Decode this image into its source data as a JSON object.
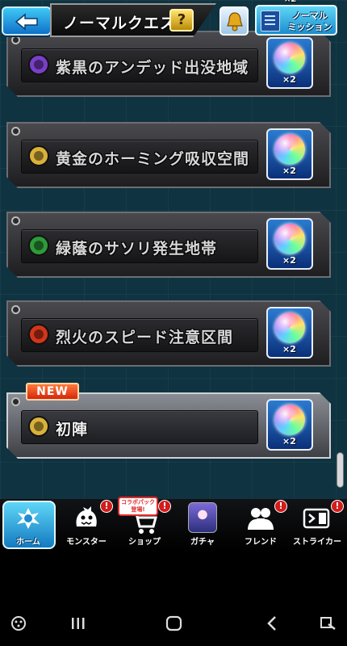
{
  "header": {
    "title": "ノーマルクエスト",
    "help_label": "?",
    "mission_line1": "ノーマル",
    "mission_line2": "ミッション"
  },
  "quests": [
    {
      "name": "紫黒のアンデッド出没地域",
      "element": "dark",
      "element_color": "#7a3fc8",
      "reward": "×2"
    },
    {
      "name": "黄金のホーミング吸収空間",
      "element": "light",
      "element_color": "#d9b23a",
      "reward": "×2"
    },
    {
      "name": "緑蔭のサソリ発生地帯",
      "element": "wood",
      "element_color": "#2f9a3a",
      "reward": "×2"
    },
    {
      "name": "烈火のスピード注意区間",
      "element": "fire",
      "element_color": "#d2361a",
      "reward": "×2"
    },
    {
      "name": "初陣",
      "element": "light",
      "element_color": "#d9b23a",
      "reward": "×2",
      "badge": "NEW"
    }
  ],
  "partial_reward": "×2",
  "nav": {
    "items": [
      {
        "label": "ホーム",
        "icon": "home-icon",
        "active": true
      },
      {
        "label": "モンスター",
        "icon": "monster-icon",
        "alert": "!"
      },
      {
        "label": "ショップ",
        "icon": "shop-cart-icon",
        "alert": "!",
        "tag_line1": "コラボパック",
        "tag_line2": "登場!"
      },
      {
        "label": "ガチャ",
        "icon": "gacha-icon"
      },
      {
        "label": "フレンド",
        "icon": "friend-icon",
        "alert": "!"
      },
      {
        "label": "ストライカー",
        "icon": "striker-card-icon",
        "alert": "!"
      }
    ]
  },
  "colors": {
    "accent": "#1b8ccc",
    "background": "#0f3340",
    "badge_new": "#d4260c",
    "alert": "#d31c1c"
  }
}
